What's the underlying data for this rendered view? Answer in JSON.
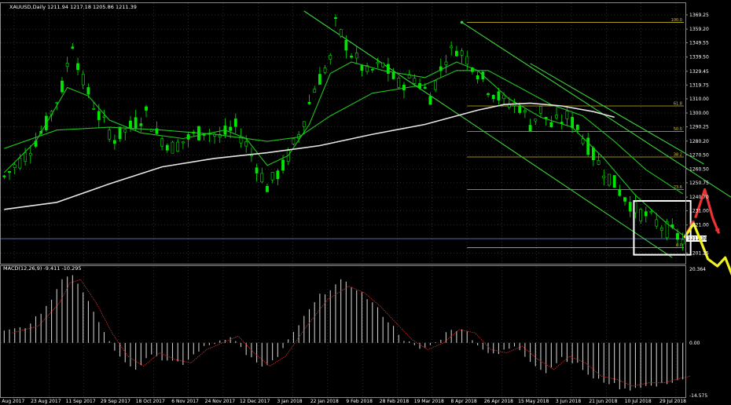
{
  "chart_data": [
    {
      "type": "candlestick",
      "symbol_header": "XAUUSD,Daily  1211.94 1217.18 1205.86 1211.39",
      "current_price_label": "1211.39",
      "y_ticks": [
        "1369.25",
        "1359.20",
        "1349.55",
        "1339.50",
        "1329.45",
        "1319.75",
        "1310.00",
        "1300.00",
        "1290.25",
        "1280.20",
        "1270.50",
        "1260.50",
        "1250.75",
        "1240.70",
        "1231.00",
        "1221.00",
        "1201.25"
      ],
      "x_ticks": [
        "4 Aug 2017",
        "23 Aug 2017",
        "11 Sep 2017",
        "29 Sep 2017",
        "18 Oct 2017",
        "6 Nov 2017",
        "24 Nov 2017",
        "12 Dec 2017",
        "3 Jan 2018",
        "22 Jan 2018",
        "9 Feb 2018",
        "28 Feb 2018",
        "19 Mar 2018",
        "8 Apr 2018",
        "26 Apr 2018",
        "15 May 2018",
        "3 Jun 2018",
        "21 Jun 2018",
        "10 Jul 2018",
        "29 Jul 2018"
      ],
      "ylim": [
        1197,
        1372
      ],
      "price_path": [
        [
          0,
          1255
        ],
        [
          4,
          1270
        ],
        [
          8,
          1292
        ],
        [
          11,
          1318
        ],
        [
          13,
          1350
        ],
        [
          15,
          1322
        ],
        [
          18,
          1298
        ],
        [
          21,
          1282
        ],
        [
          24,
          1290
        ],
        [
          27,
          1300
        ],
        [
          29,
          1285
        ],
        [
          32,
          1276
        ],
        [
          35,
          1282
        ],
        [
          38,
          1288
        ],
        [
          41,
          1283
        ],
        [
          44,
          1290
        ],
        [
          46,
          1278
        ],
        [
          48,
          1263
        ],
        [
          50,
          1248
        ],
        [
          53,
          1262
        ],
        [
          56,
          1285
        ],
        [
          59,
          1318
        ],
        [
          62,
          1338
        ],
        [
          63,
          1362
        ],
        [
          66,
          1342
        ],
        [
          69,
          1328
        ],
        [
          72,
          1334
        ],
        [
          75,
          1320
        ],
        [
          78,
          1325
        ],
        [
          81,
          1312
        ],
        [
          84,
          1340
        ],
        [
          86,
          1346
        ],
        [
          89,
          1335
        ],
        [
          92,
          1318
        ],
        [
          95,
          1308
        ],
        [
          98,
          1305
        ],
        [
          100,
          1292
        ],
        [
          102,
          1302
        ],
        [
          104,
          1291
        ],
        [
          107,
          1297
        ],
        [
          109,
          1290
        ],
        [
          112,
          1270
        ],
        [
          115,
          1255
        ],
        [
          117,
          1245
        ],
        [
          120,
          1232
        ],
        [
          123,
          1225
        ],
        [
          126,
          1218
        ],
        [
          129,
          1210
        ]
      ],
      "moving_averages": [
        {
          "name": "MA fast",
          "color": "#1fc41f",
          "values": [
            [
              0,
              1258
            ],
            [
              6,
              1280
            ],
            [
              12,
              1318
            ],
            [
              16,
              1312
            ],
            [
              20,
              1295
            ],
            [
              26,
              1286
            ],
            [
              34,
              1282
            ],
            [
              42,
              1288
            ],
            [
              46,
              1282
            ],
            [
              50,
              1263
            ],
            [
              54,
              1270
            ],
            [
              58,
              1292
            ],
            [
              62,
              1328
            ],
            [
              66,
              1336
            ],
            [
              72,
              1330
            ],
            [
              80,
              1325
            ],
            [
              86,
              1336
            ],
            [
              90,
              1330
            ],
            [
              96,
              1310
            ],
            [
              102,
              1297
            ],
            [
              108,
              1290
            ],
            [
              114,
              1268
            ],
            [
              120,
              1242
            ],
            [
              126,
              1222
            ],
            [
              129,
              1214
            ]
          ]
        },
        {
          "name": "MA mid",
          "color": "#1fc41f",
          "values": [
            [
              0,
              1275
            ],
            [
              10,
              1288
            ],
            [
              20,
              1290
            ],
            [
              30,
              1288
            ],
            [
              40,
              1285
            ],
            [
              50,
              1280
            ],
            [
              56,
              1283
            ],
            [
              62,
              1298
            ],
            [
              70,
              1314
            ],
            [
              80,
              1320
            ],
            [
              86,
              1330
            ],
            [
              92,
              1330
            ],
            [
              98,
              1318
            ],
            [
              104,
              1306
            ],
            [
              110,
              1298
            ],
            [
              116,
              1280
            ],
            [
              122,
              1260
            ],
            [
              129,
              1243
            ]
          ]
        },
        {
          "name": "MA slow",
          "color": "#e6e6e6",
          "values": [
            [
              0,
              1232
            ],
            [
              10,
              1237
            ],
            [
              20,
              1250
            ],
            [
              30,
              1262
            ],
            [
              40,
              1268
            ],
            [
              50,
              1272
            ],
            [
              60,
              1277
            ],
            [
              70,
              1285
            ],
            [
              80,
              1292
            ],
            [
              90,
              1302
            ],
            [
              95,
              1306
            ],
            [
              100,
              1307
            ],
            [
              106,
              1305
            ],
            [
              112,
              1301
            ],
            [
              116,
              1297
            ]
          ]
        }
      ],
      "fibonacci_levels": [
        {
          "label": "100.0",
          "price": 1364
        },
        {
          "label": "61.8",
          "price": 1305
        },
        {
          "label": "50.0",
          "price": 1287
        },
        {
          "label": "38.2",
          "price": 1269
        },
        {
          "label": "23.6",
          "price": 1246
        },
        {
          "label": "0.0",
          "price": 1205
        }
      ],
      "colors": {
        "bull": "#00e600",
        "bear": "#00e600",
        "fib": "#c8b41e",
        "channel": "#3cd23c",
        "grid": "#5a5a5a",
        "current_line": "#8fa5ff",
        "box": "#ffffff",
        "arrow_yellow": "#f2f21e",
        "arrow_red": "#ee3232"
      }
    },
    {
      "type": "bar",
      "title": "MACD(12,26,9) -9.411 -10.295",
      "y_ticks": [
        "20.364",
        "0.00",
        "-14.575"
      ],
      "ylim": [
        -15,
        21
      ],
      "histogram_path": [
        [
          0,
          3
        ],
        [
          5,
          5
        ],
        [
          9,
          12
        ],
        [
          11,
          18
        ],
        [
          13,
          19
        ],
        [
          16,
          12
        ],
        [
          19,
          3
        ],
        [
          22,
          -4
        ],
        [
          25,
          -7
        ],
        [
          28,
          -3
        ],
        [
          31,
          -5
        ],
        [
          34,
          -6
        ],
        [
          37,
          -2
        ],
        [
          40,
          0
        ],
        [
          43,
          2
        ],
        [
          46,
          -3
        ],
        [
          49,
          -7
        ],
        [
          52,
          -4
        ],
        [
          56,
          5
        ],
        [
          60,
          13
        ],
        [
          64,
          17
        ],
        [
          67,
          15
        ],
        [
          70,
          11
        ],
        [
          73,
          6
        ],
        [
          76,
          1
        ],
        [
          79,
          -2
        ],
        [
          82,
          0
        ],
        [
          85,
          4
        ],
        [
          88,
          3
        ],
        [
          91,
          -2
        ],
        [
          94,
          -3
        ],
        [
          97,
          -1
        ],
        [
          100,
          -5
        ],
        [
          103,
          -8
        ],
        [
          106,
          -4
        ],
        [
          109,
          -6
        ],
        [
          112,
          -10
        ],
        [
          115,
          -11
        ],
        [
          118,
          -13
        ],
        [
          121,
          -12
        ],
        [
          124,
          -12
        ],
        [
          126,
          -11
        ],
        [
          129,
          -10
        ]
      ],
      "signal_color": "#d23232",
      "bar_color": "#c8c8c8"
    }
  ]
}
